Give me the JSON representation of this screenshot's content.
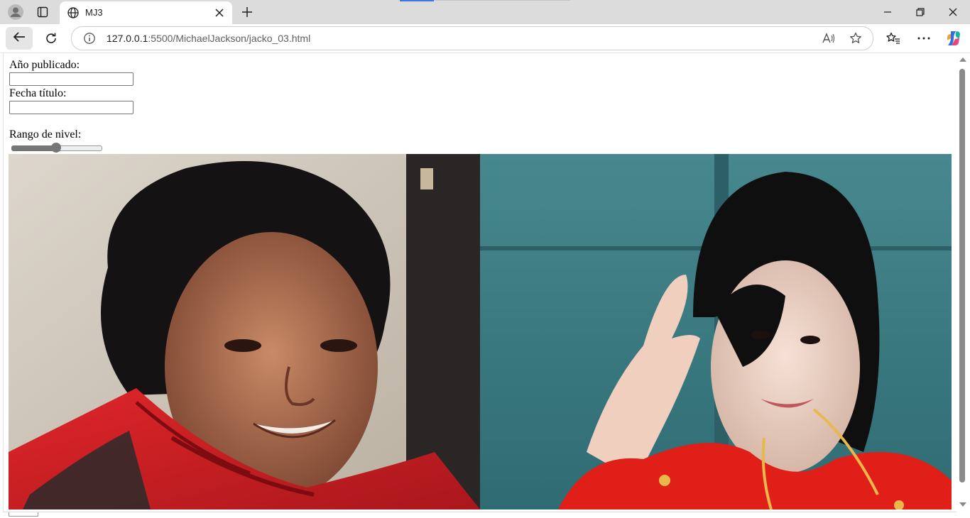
{
  "browser": {
    "tab_title": "MJ3",
    "url_host": "127.0.0.1",
    "url_path": ":5500/MichaelJackson/jacko_03.html",
    "accent_color": "#3a78e0"
  },
  "form": {
    "year_label": "Año publicado:",
    "year_value": "",
    "date_label": "Fecha título:",
    "date_value": "",
    "range_label": "Rango de nivel:",
    "range_value_fraction": 0.5
  },
  "photos": [
    {
      "name": "photo-left",
      "subject": "man with curly hair in red leather jacket"
    },
    {
      "name": "photo-right",
      "subject": "man waving in red jacket against teal wall"
    }
  ],
  "icons": {
    "profile": "profile-icon",
    "tabs": "tab-actions-icon",
    "globe": "globe-icon",
    "close": "close-icon",
    "new_tab": "plus-icon",
    "back": "back-arrow-icon",
    "reload": "reload-icon",
    "info": "info-icon",
    "read_aloud": "read-aloud-icon",
    "favorite": "star-icon",
    "favorites": "favorites-icon",
    "more": "more-icon",
    "copilot": "copilot-icon"
  }
}
